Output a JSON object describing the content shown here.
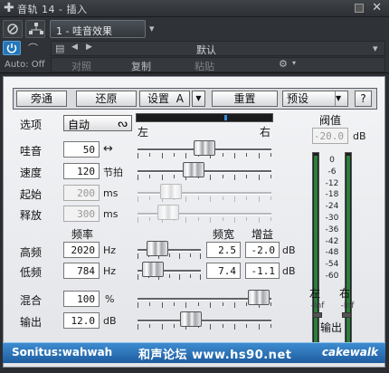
{
  "window": {
    "title": "音轨 14 - 插入"
  },
  "toolbar": {
    "chain_tab": "1 - 哇音效果",
    "preset_value": "默认",
    "compare_label": "对照",
    "copy_label": "复制",
    "paste_label": "粘贴",
    "auto_off": "Auto: Off"
  },
  "buttons": {
    "bypass": "旁通",
    "reset": "还原",
    "setup": "设置",
    "setup_value": "A",
    "zero": "重置",
    "preset": "预设",
    "help": "?"
  },
  "mode": {
    "label": "选项",
    "value": "自动",
    "left": "左",
    "right": "右"
  },
  "threshold": {
    "label": "阀值",
    "value": "-20.0",
    "unit": "dB"
  },
  "params": {
    "wah": {
      "label": "哇音",
      "value": "50",
      "unit": "↔",
      "level": 0.5
    },
    "speed": {
      "label": "速度",
      "value": "120",
      "unit": "节拍",
      "level": 0.4
    },
    "start": {
      "label": "起始",
      "value": "200",
      "unit": "ms",
      "level": 0.2
    },
    "release": {
      "label": "释放",
      "value": "300",
      "unit": "ms",
      "level": 0.18
    }
  },
  "bands": {
    "freq_header": "频率",
    "width_header": "频宽",
    "gain_header": "增益",
    "high": {
      "label": "高频",
      "freq": "2020",
      "freq_unit": "Hz",
      "width": "2.5",
      "gain": "-2.0",
      "gain_unit": "dB",
      "level": 0.22
    },
    "low": {
      "label": "低频",
      "freq": "784",
      "freq_unit": "Hz",
      "width": "7.4",
      "gain": "-1.1",
      "gain_unit": "dB",
      "level": 0.1
    }
  },
  "mix": {
    "label": "混合",
    "value": "100",
    "unit": "%",
    "level": 0.98
  },
  "output": {
    "label": "输出",
    "value": "12.0",
    "unit": "dB",
    "level": 0.38
  },
  "meters": {
    "scale": [
      "0",
      "-6",
      "-12",
      "-18",
      "-24",
      "-30",
      "-36",
      "-42",
      "-48",
      "-54",
      "-60"
    ],
    "left_label": "左",
    "right_label": "右",
    "left_peak": "-Inf",
    "right_peak": "-Inf",
    "out_label": "输出",
    "left_level": 0.98,
    "right_level": 0.98
  },
  "footer": {
    "plugin_name": "Sonitus:wahwah",
    "site": "和声论坛 www.hs90.net",
    "brand": "cakewalk"
  }
}
